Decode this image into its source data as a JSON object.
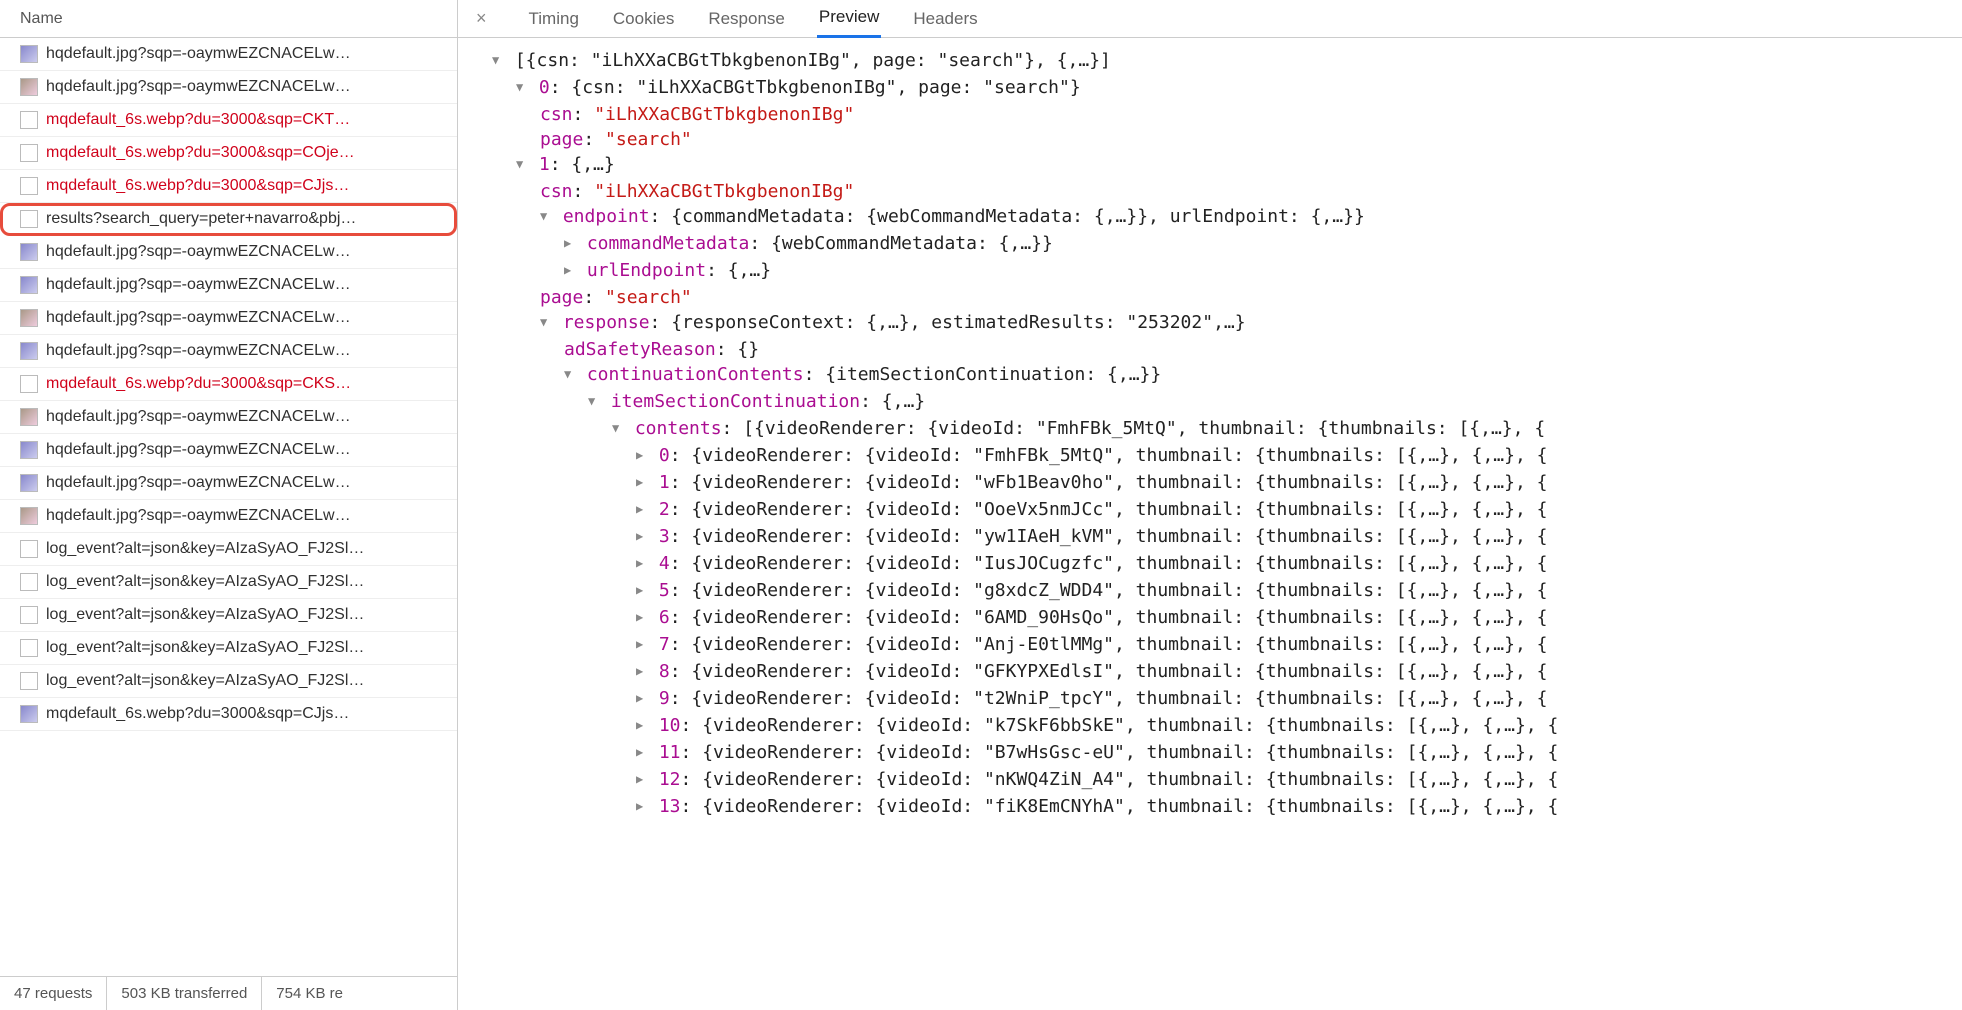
{
  "sidebar": {
    "header": "Name",
    "requests": [
      {
        "label": "hqdefault.jpg?sqp=-oaymwEZCNACELw…",
        "red": false,
        "iconClass": "img"
      },
      {
        "label": "hqdefault.jpg?sqp=-oaymwEZCNACELw…",
        "red": false,
        "iconClass": "img2"
      },
      {
        "label": "mqdefault_6s.webp?du=3000&sqp=CKT…",
        "red": true,
        "iconClass": ""
      },
      {
        "label": "mqdefault_6s.webp?du=3000&sqp=COje…",
        "red": true,
        "iconClass": ""
      },
      {
        "label": "mqdefault_6s.webp?du=3000&sqp=CJjs…",
        "red": true,
        "iconClass": ""
      },
      {
        "label": "results?search_query=peter+navarro&pbj…",
        "red": false,
        "iconClass": "",
        "highlighted": true
      },
      {
        "label": "hqdefault.jpg?sqp=-oaymwEZCNACELw…",
        "red": false,
        "iconClass": "img"
      },
      {
        "label": "hqdefault.jpg?sqp=-oaymwEZCNACELw…",
        "red": false,
        "iconClass": "img"
      },
      {
        "label": "hqdefault.jpg?sqp=-oaymwEZCNACELw…",
        "red": false,
        "iconClass": "img2"
      },
      {
        "label": "hqdefault.jpg?sqp=-oaymwEZCNACELw…",
        "red": false,
        "iconClass": "img"
      },
      {
        "label": "mqdefault_6s.webp?du=3000&sqp=CKS…",
        "red": true,
        "iconClass": ""
      },
      {
        "label": "hqdefault.jpg?sqp=-oaymwEZCNACELw…",
        "red": false,
        "iconClass": "img2"
      },
      {
        "label": "hqdefault.jpg?sqp=-oaymwEZCNACELw…",
        "red": false,
        "iconClass": "img"
      },
      {
        "label": "hqdefault.jpg?sqp=-oaymwEZCNACELw…",
        "red": false,
        "iconClass": "img"
      },
      {
        "label": "hqdefault.jpg?sqp=-oaymwEZCNACELw…",
        "red": false,
        "iconClass": "img2"
      },
      {
        "label": "log_event?alt=json&key=AIzaSyAO_FJ2Sl…",
        "red": false,
        "iconClass": ""
      },
      {
        "label": "log_event?alt=json&key=AIzaSyAO_FJ2Sl…",
        "red": false,
        "iconClass": ""
      },
      {
        "label": "log_event?alt=json&key=AIzaSyAO_FJ2Sl…",
        "red": false,
        "iconClass": ""
      },
      {
        "label": "log_event?alt=json&key=AIzaSyAO_FJ2Sl…",
        "red": false,
        "iconClass": ""
      },
      {
        "label": "log_event?alt=json&key=AIzaSyAO_FJ2Sl…",
        "red": false,
        "iconClass": ""
      },
      {
        "label": "mqdefault_6s.webp?du=3000&sqp=CJjs…",
        "red": false,
        "iconClass": "img"
      }
    ],
    "footer": {
      "requests": "47 requests",
      "transferred": "503 KB transferred",
      "resources": "754 KB re"
    }
  },
  "tabs": [
    "Headers",
    "Preview",
    "Response",
    "Cookies",
    "Timing"
  ],
  "activeTab": "Preview",
  "preview": {
    "csn": "iLhXXaCBGtTbkgbenonIBg",
    "page": "search",
    "estimatedResults": "253202",
    "videoIds": [
      "FmhFBk_5MtQ",
      "wFb1Beav0ho",
      "OoeVx5nmJCc",
      "yw1IAeH_kVM",
      "IusJOCugzfc",
      "g8xdcZ_WDD4",
      "6AMD_90HsQo",
      "Anj-E0tlMMg",
      "GFKYPXEdlsI",
      "t2WniP_tpcY",
      "k7SkF6bbSkE",
      "B7wHsGsc-eU",
      "nKWQ4ZiN_A4",
      "fiK8EmCNYhA"
    ]
  }
}
